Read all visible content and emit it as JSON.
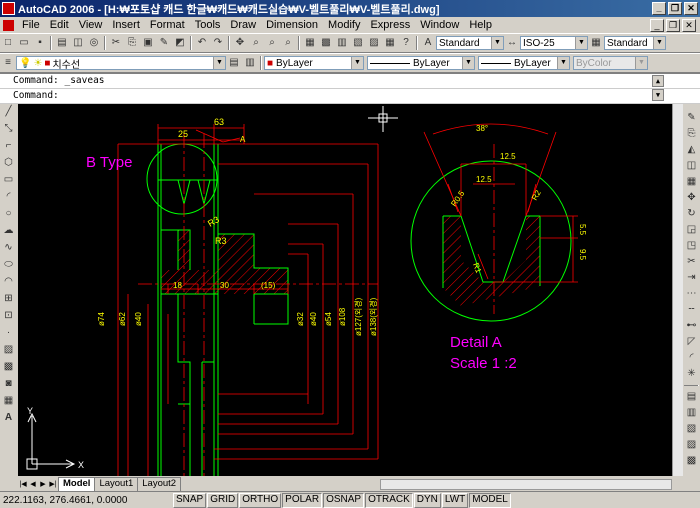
{
  "window": {
    "title": "AutoCAD 2006 - [H:₩포토샵 캐드 한글₩캐드₩캐드실습₩V-벨트풀리₩V-벨트풀리.dwg]"
  },
  "menu": [
    "File",
    "Edit",
    "View",
    "Insert",
    "Format",
    "Tools",
    "Draw",
    "Dimension",
    "Modify",
    "Express",
    "Window",
    "Help"
  ],
  "styles": {
    "text_style": "Standard",
    "dim_style": "ISO-25",
    "table_style": "Standard"
  },
  "layers": {
    "current_layer": "치수선",
    "color": "ByLayer",
    "linetype": "ByLayer",
    "lineweight": "ByLayer",
    "plotstyle": "ByColor"
  },
  "command": {
    "line1": "Command: _saveas",
    "line2": "Command:"
  },
  "drawing": {
    "texts": [
      "B Type",
      "63",
      "25",
      "A",
      "R3",
      "R3",
      "18",
      "30",
      "(15)",
      "ø74",
      "ø62",
      "ø40",
      "ø32",
      "ø40",
      "ø54",
      "ø108",
      "ø127(외경)",
      "ø138(외경)",
      "38°",
      "12.5",
      "12.5",
      "R0.5",
      "R1",
      "R2",
      "5.5",
      "9.5",
      "Detail A",
      "Scale 1 :2"
    ],
    "axis": {
      "x": "X",
      "y": "Y"
    }
  },
  "tabs": [
    "Model",
    "Layout1",
    "Layout2"
  ],
  "status": {
    "coords": "222.1163, 276.4661, 0.0000",
    "buttons": [
      "SNAP",
      "GRID",
      "ORTHO",
      "POLAR",
      "OSNAP",
      "OTRACK",
      "DYN",
      "LWT",
      "MODEL"
    ],
    "active": [
      "POLAR",
      "OSNAP",
      "OTRACK",
      "MODEL"
    ]
  },
  "colors": {
    "background": "#000000",
    "green": "#00ff00",
    "red": "#ff0000",
    "yellow": "#ffff00",
    "magenta": "#ff00ff",
    "titlebar": "#0a246a"
  }
}
